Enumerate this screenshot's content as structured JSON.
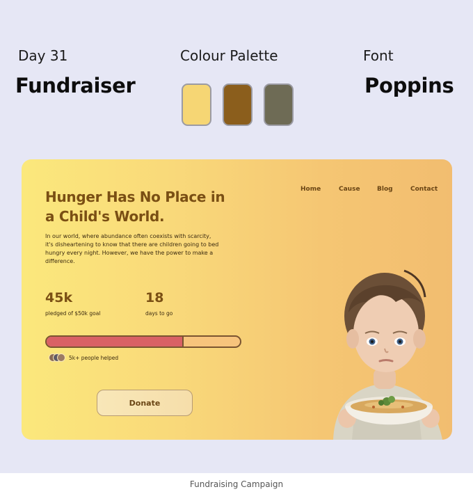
{
  "header": {
    "day": "Day 31",
    "project": "Fundraiser",
    "palette_title": "Colour Palette",
    "palette": [
      "#f6d674",
      "#8b5e1c",
      "#6e6b55"
    ],
    "font_title": "Font",
    "font_name": "Poppins"
  },
  "card": {
    "nav": [
      "Home",
      "Cause",
      "Blog",
      "Contact"
    ],
    "title": "Hunger Has No Place in a Child's World.",
    "description": "In our world, where abundance often coexists with scarcity, it's disheartening to know that there are children going to bed hungry every night. However, we have the power to make a difference.",
    "stats": [
      {
        "value": "45k",
        "label": "pledged of $50k goal"
      },
      {
        "value": "18",
        "label": "days to go"
      }
    ],
    "progress_fraction": 0.71,
    "helped": "5k+ people helped",
    "donate_label": "Donate",
    "colors": {
      "accent": "#7a4f14",
      "progress": "#d96165",
      "track": "#f7c47c"
    }
  },
  "footer": {
    "caption": "Fundraising Campaign"
  }
}
